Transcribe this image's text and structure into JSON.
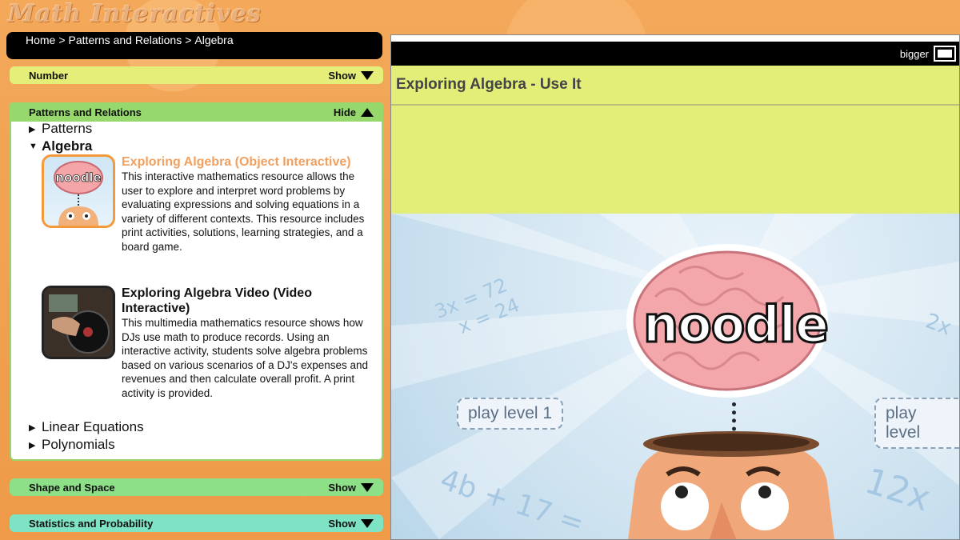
{
  "logo": "Math Interactives",
  "breadcrumb": [
    "Home",
    ">",
    "Patterns and Relations",
    ">",
    "Algebra"
  ],
  "sections": {
    "number": {
      "title": "Number",
      "toggle": "Show"
    },
    "patterns": {
      "title": "Patterns and Relations",
      "toggle": "Hide"
    },
    "shape": {
      "title": "Shape and Space",
      "toggle": "Show"
    },
    "stats": {
      "title": "Statistics and Probability",
      "toggle": "Show"
    }
  },
  "tree": {
    "patterns": "Patterns",
    "algebra": "Algebra",
    "linear": "Linear Equations",
    "polynomials": "Polynomials"
  },
  "items": [
    {
      "title": "Exploring Algebra (Object Interactive)",
      "desc": "This interactive mathematics resource allows the user to explore and interpret word problems by evaluating expressions and solving equations in a variety of different contexts. This resource includes print activities, solutions, learning strategies, and a board game."
    },
    {
      "title": "Exploring Algebra Video (Video Interactive)",
      "desc": "This multimedia mathematics resource shows how DJs use math to produce records. Using an interactive activity, students solve algebra problems based on various scenarios of a DJ's expenses and revenues and then calculate overall profit. A print activity is provided."
    }
  ],
  "viewer": {
    "bigger": "bigger",
    "title": "Exploring Algebra - Use It",
    "game": {
      "logo_text": "noodle",
      "thumb_logo_text": "noodle",
      "play1": "play level 1",
      "play2": "play level",
      "deco1": "3x = 72",
      "deco2": "x = 24",
      "deco3": "2x",
      "deco4": "4b + 17 =",
      "deco5": "12x"
    }
  },
  "colors": {
    "number": "#e4ee78",
    "patterns": "#97d86c",
    "shape": "#8ee088",
    "stats": "#7ee2c4",
    "highlight": "#f0a060"
  }
}
